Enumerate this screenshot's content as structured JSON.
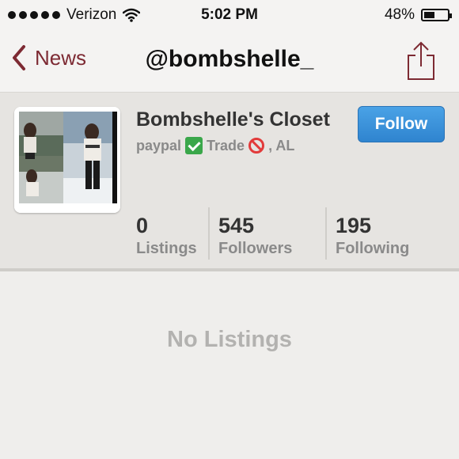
{
  "status_bar": {
    "carrier": "Verizon",
    "time": "5:02 PM",
    "battery_percent": "48%",
    "battery_level": 0.48,
    "signal_icon": "signal-dots-icon",
    "wifi_icon": "wifi-icon"
  },
  "nav": {
    "back_label": "News",
    "title": "@bombshelle_",
    "back_icon": "chevron-left-icon",
    "share_icon": "share-icon"
  },
  "profile": {
    "closet_name": "Bombshelle's Closet",
    "desc_part1": "paypal",
    "desc_part2": "Trade",
    "desc_part3": ", AL",
    "follow_label": "Follow",
    "stats": [
      {
        "value": "0",
        "label": "Listings"
      },
      {
        "value": "545",
        "label": "Followers"
      },
      {
        "value": "195",
        "label": "Following"
      }
    ]
  },
  "listings": {
    "empty_text": "No Listings"
  },
  "colors": {
    "accent": "#7d2a33",
    "follow_button": "#3a93dc",
    "check": "#3aa74a",
    "prohibited": "#e23b3b"
  }
}
